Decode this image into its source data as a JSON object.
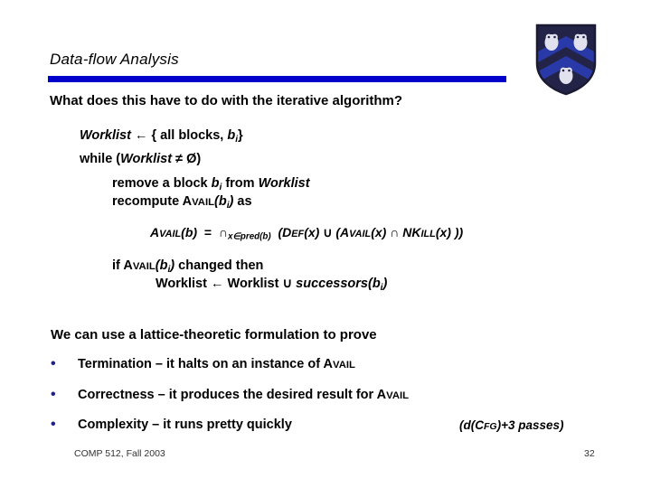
{
  "slide": {
    "title": "Data-flow Analysis",
    "rule_color": "#0000CC",
    "question": "What does this have to do with the iterative algorithm?",
    "algorithm": {
      "worklist_init": {
        "name_italic": "Worklist",
        "arrow": "←",
        "rest": "{ all blocks, ",
        "var": "b",
        "var_sub": "i",
        "close": "}"
      },
      "while_line": {
        "keyword": "while (",
        "name_italic": "Worklist",
        "neq": "≠",
        "empty": "Ø",
        "close": ")"
      },
      "remove_line": {
        "text_a": "remove a block ",
        "var": "b",
        "var_sub": "i",
        "text_b": " from ",
        "name_italic": "Worklist"
      },
      "recompute_line": {
        "text_a": "recompute ",
        "fn_first": "A",
        "fn_rest": "VAIL",
        "open": "(",
        "var": "b",
        "var_sub": "i",
        "close": ")",
        "text_b": " as"
      },
      "equation": {
        "lhs_first": "A",
        "lhs_rest": "VAIL",
        "lhs_arg": "(b)",
        "equals": "=",
        "meet": "∩",
        "meet_sub": "x∈pred(b)",
        "open_paren": "(",
        "def_first": "D",
        "def_rest": "EF",
        "def_arg": "(x)",
        "union": "∪",
        "open_paren2": "(",
        "avail_first": "A",
        "avail_rest": "VAIL",
        "avail_arg": "(x)",
        "intersect": "∩",
        "nkill_first": "NK",
        "nkill_rest": "ILL",
        "nkill_arg": "(x)",
        "close_parens": "))"
      },
      "if_line": {
        "keyword": "if ",
        "fn_first": "A",
        "fn_rest": "VAIL",
        "open": "(",
        "var": "b",
        "var_sub": "i",
        "close": ")",
        "text_b": " changed then"
      },
      "add_successors_line": {
        "name_a": "Worklist",
        "arrow": "←",
        "name_b": "Worklist",
        "union": "∪",
        "fn_italic": "successors",
        "open": "(",
        "var": "b",
        "var_sub": "i",
        "close": ")"
      }
    },
    "lattice_intro": "We can use a lattice-theoretic formulation to prove",
    "bullets": [
      {
        "marker": "•",
        "text": "Termination – it halts on an instance of ",
        "fn_first": "A",
        "fn_rest": "VAIL"
      },
      {
        "marker": "•",
        "text": "Correctness – it produces the desired result for ",
        "fn_first": "A",
        "fn_rest": "VAIL"
      },
      {
        "marker": "•",
        "text": "Complexity – it runs pretty quickly",
        "fn_first": "",
        "fn_rest": ""
      }
    ],
    "complexity_note": {
      "open": "(d(",
      "cfg_first": "C",
      "cfg_rest": "FG",
      "rest": ")+3 passes)"
    },
    "footer": {
      "course": "COMP 512, Fall 2003",
      "page": "32"
    },
    "logo": {
      "name": "rice-university-shield",
      "shield_color": "#222244",
      "chevron_color": "#2233AA",
      "owl_color": "#DDDDE8"
    }
  }
}
